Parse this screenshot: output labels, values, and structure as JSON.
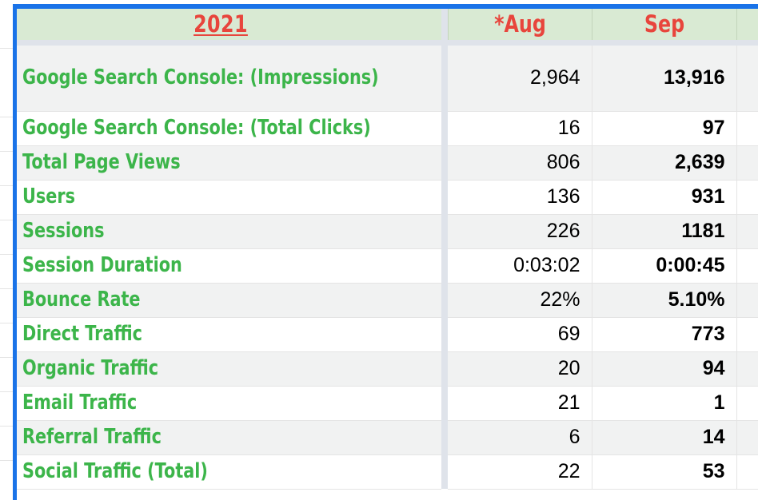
{
  "table": {
    "header": {
      "year_label": "2021",
      "columns": [
        "*Aug",
        "Sep"
      ],
      "header_bg": "#d9ead3",
      "header_text_color": "#e8453c",
      "label_text_color": "#3cb54a",
      "selection_color": "#1a73e8"
    },
    "column_headers": [
      "2021",
      "*Aug",
      "Sep",
      ""
    ],
    "rows": [
      {
        "metric": "Google Search Console: (Impressions)",
        "aug": "2,964",
        "sep": "13,916"
      },
      {
        "metric": "Google Search Console: (Total Clicks)",
        "aug": "16",
        "sep": "97"
      },
      {
        "metric": "Total Page Views",
        "aug": "806",
        "sep": "2,639"
      },
      {
        "metric": "Users",
        "aug": "136",
        "sep": "931"
      },
      {
        "metric": "Sessions",
        "aug": "226",
        "sep": "1181"
      },
      {
        "metric": "Session Duration",
        "aug": "0:03:02",
        "sep": "0:00:45"
      },
      {
        "metric": "Bounce Rate",
        "aug": "22%",
        "sep": "5.10%"
      },
      {
        "metric": "Direct Traffic",
        "aug": "69",
        "sep": "773"
      },
      {
        "metric": "Organic Traffic",
        "aug": "20",
        "sep": "94"
      },
      {
        "metric": "Email Traffic",
        "aug": "21",
        "sep": "1"
      },
      {
        "metric": "Referral Traffic",
        "aug": "6",
        "sep": "14"
      },
      {
        "metric": "Social Traffic (Total)",
        "aug": "22",
        "sep": "53"
      }
    ]
  }
}
